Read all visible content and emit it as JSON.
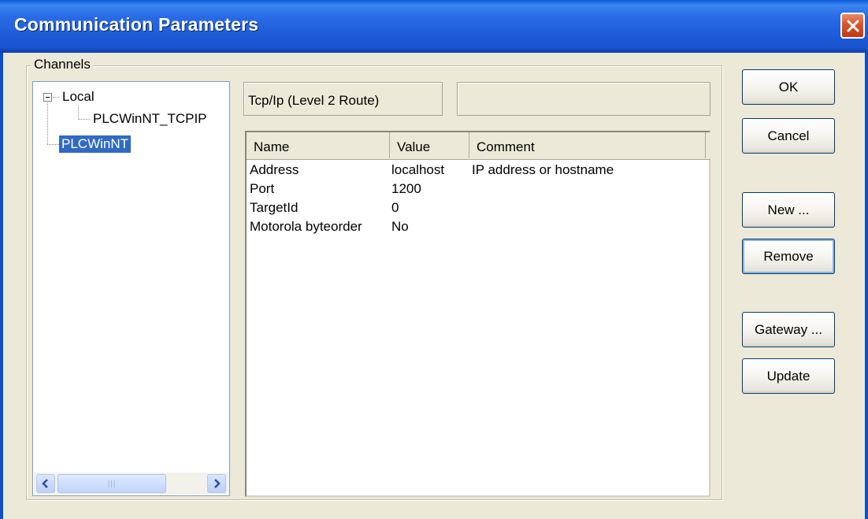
{
  "window": {
    "title": "Communication Parameters"
  },
  "channels": {
    "label": "Channels",
    "tree": {
      "local": "Local",
      "local_child": "PLCWinNT_TCPIP",
      "selected": "PLCWinNT"
    }
  },
  "driver": {
    "name": "Tcp/Ip (Level 2 Route)",
    "extra": ""
  },
  "params": {
    "columns": [
      "Name",
      "Value",
      "Comment"
    ],
    "rows": [
      {
        "name": "Address",
        "value": "localhost",
        "comment": "IP address or hostname"
      },
      {
        "name": "Port",
        "value": "1200",
        "comment": ""
      },
      {
        "name": "TargetId",
        "value": "0",
        "comment": ""
      },
      {
        "name": "Motorola byteorder",
        "value": "No",
        "comment": ""
      }
    ]
  },
  "buttons": {
    "ok": "OK",
    "cancel": "Cancel",
    "new": "New ...",
    "remove": "Remove",
    "gateway": "Gateway ...",
    "update": "Update"
  }
}
